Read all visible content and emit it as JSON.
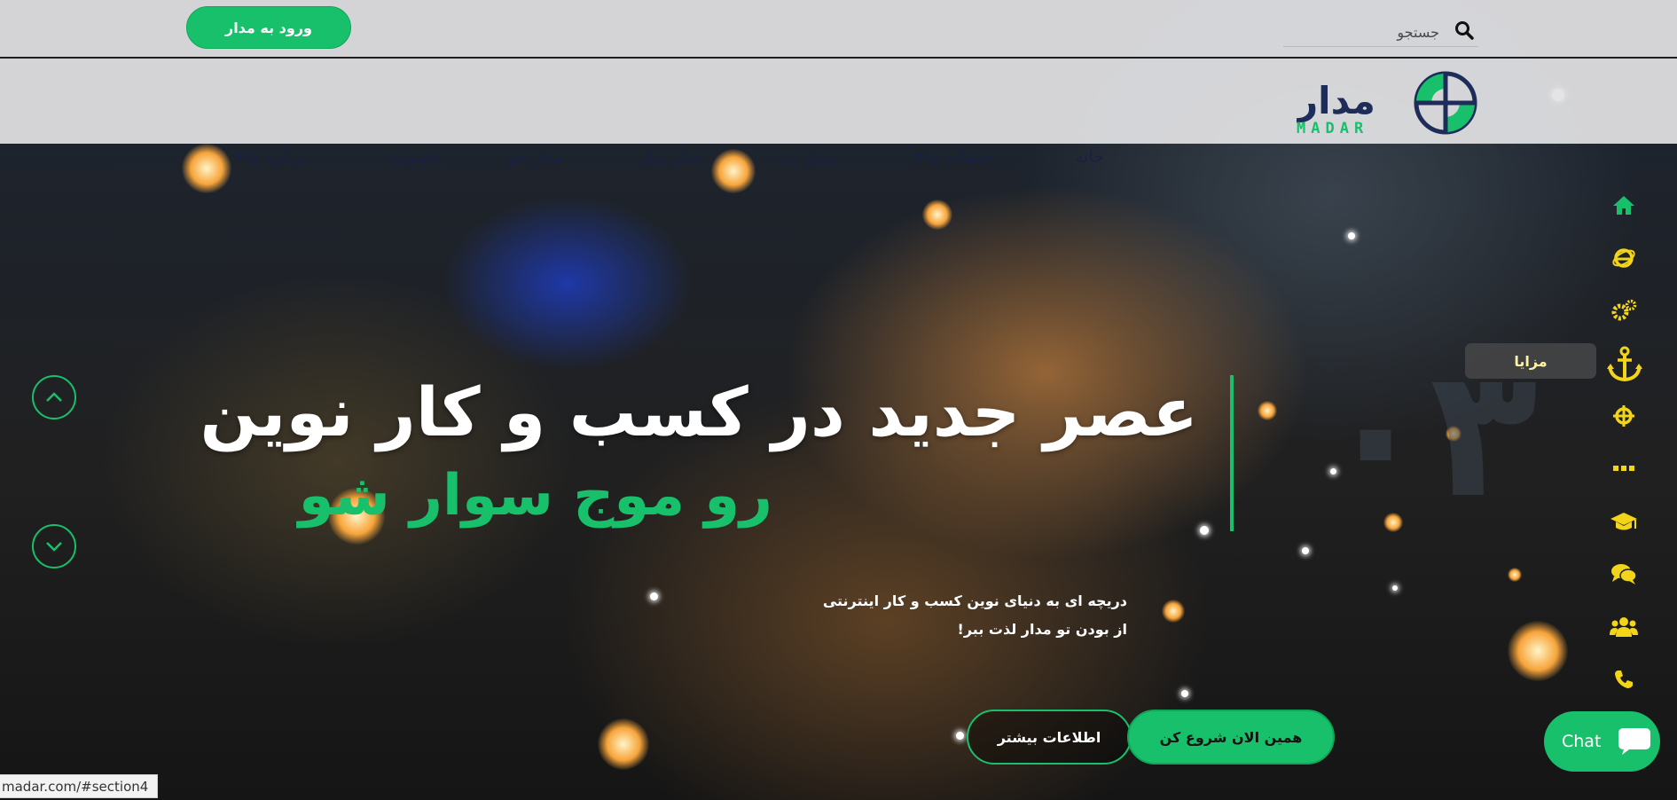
{
  "topbar": {
    "login_label": "ورود به مدار",
    "search_placeholder": "جستجو"
  },
  "logo": {
    "fa_text": "مدار",
    "en_text": "MADAR",
    "colors": {
      "green": "#19c06b",
      "navy": "#1e2c5a"
    }
  },
  "nav": {
    "items": [
      {
        "label": "خانه",
        "dropdown": false
      },
      {
        "label": "خدمات ما",
        "dropdown": true
      },
      {
        "label": "مدار نت",
        "dropdown": false
      },
      {
        "label": "مدار سل",
        "dropdown": false
      },
      {
        "label": "مدار جو",
        "dropdown": false
      },
      {
        "label": "عضویت",
        "dropdown": false
      },
      {
        "label": "درباره ما",
        "dropdown": true
      }
    ]
  },
  "side_rail": {
    "icons": [
      "home-icon",
      "internet-explorer-icon",
      "gears-icon",
      "anchor-icon",
      "crosshairs-icon",
      "ellipsis-icon",
      "graduation-cap-icon",
      "comments-icon",
      "users-icon",
      "phone-icon"
    ],
    "active_index": 3,
    "tooltip": "مزایا",
    "colors": {
      "green": "#19c06b",
      "yellow": "#f2d418"
    }
  },
  "hero": {
    "section_number": "۰۳",
    "headline": "عصر جدید در کسب و کار نوین",
    "subhead": "رو موج سوار شو",
    "description": [
      "دریچه ای به دنیای نوین کسب و کار اینترنتی",
      "از بودن تو مدار لذت ببر!"
    ],
    "primary_button": "همین الان شروع کن",
    "secondary_button": "اطلاعات بیشتر",
    "accent_color": "#19c06b"
  },
  "chat": {
    "label": "Chat"
  },
  "status_bar": {
    "url": "madar.com/#section4"
  }
}
